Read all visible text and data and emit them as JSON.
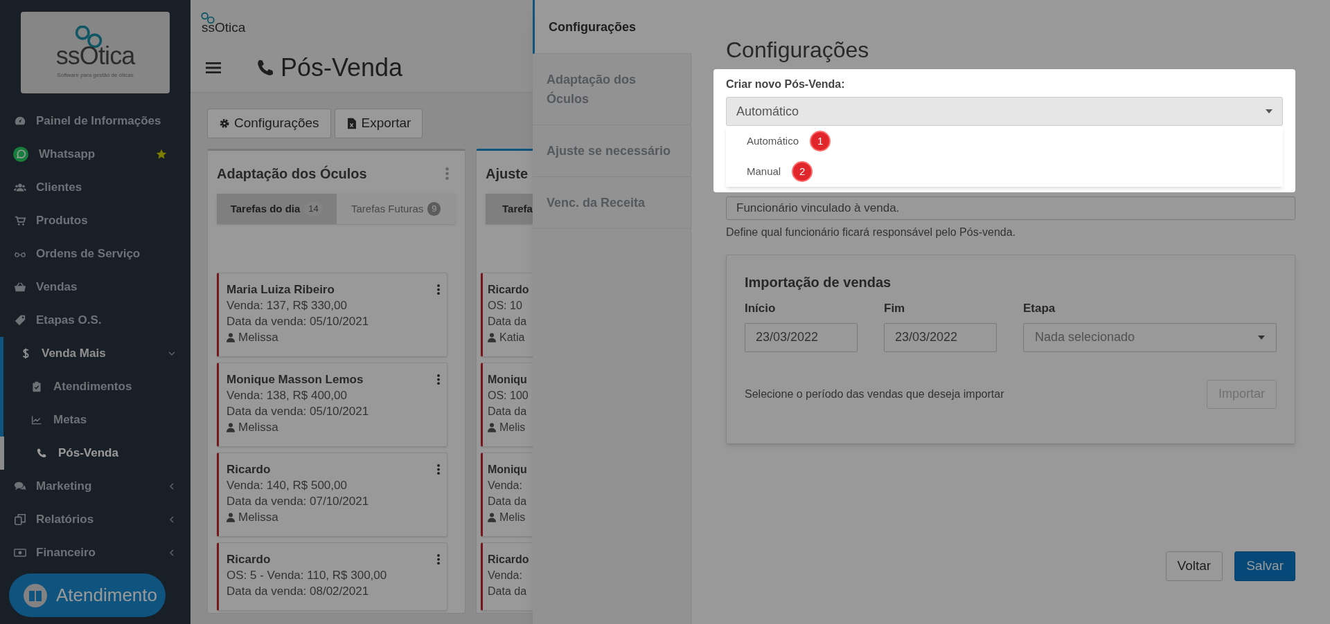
{
  "sidebar": {
    "logo": {
      "title": "ssOtica",
      "tagline": "Software para gestão de óticas"
    },
    "items": [
      {
        "label": "Painel de Informações",
        "kind": "link",
        "starred": false,
        "selected": false
      },
      {
        "label": "Whatsapp",
        "kind": "link",
        "starred": true,
        "selected": false
      },
      {
        "label": "Clientes",
        "kind": "link",
        "starred": false,
        "selected": false
      },
      {
        "label": "Produtos",
        "kind": "link",
        "starred": false,
        "selected": false
      },
      {
        "label": "Ordens de Serviço",
        "kind": "link",
        "starred": false,
        "selected": false
      },
      {
        "label": "Vendas",
        "kind": "link",
        "starred": false,
        "selected": false
      },
      {
        "label": "Etapas O.S.",
        "kind": "link",
        "starred": false,
        "selected": false
      },
      {
        "label": "Venda Mais",
        "kind": "group",
        "starred": false,
        "selected": false,
        "expanded": true,
        "children": [
          {
            "label": "Atendimentos",
            "selected": false
          },
          {
            "label": "Metas",
            "selected": false
          },
          {
            "label": "Pós-Venda",
            "selected": true
          }
        ]
      },
      {
        "label": "Marketing",
        "kind": "group",
        "starred": false,
        "selected": false,
        "expanded": false
      },
      {
        "label": "Relatórios",
        "kind": "group",
        "starred": false,
        "selected": false,
        "expanded": false
      },
      {
        "label": "Financeiro",
        "kind": "group",
        "starred": false,
        "selected": false,
        "expanded": false
      }
    ]
  },
  "chat_button": {
    "label": "Atendimento"
  },
  "header": {
    "brand": "ssOtica",
    "title": "Pós-Venda"
  },
  "toolbar": [
    {
      "label": "Configurações"
    },
    {
      "label": "Exportar"
    }
  ],
  "columns": [
    {
      "title": "Adaptação dos Óculos",
      "tabs": [
        {
          "label": "Tarefas do dia",
          "count": "14",
          "selected": true
        },
        {
          "label": "Tarefas Futuras",
          "count": "9",
          "selected": false
        }
      ],
      "cards": [
        {
          "name": "Maria Luiza Ribeiro",
          "line_1": "Venda: 137, R$ 330,00",
          "line_2": "Data da venda: 05/10/2021",
          "person": "Melissa"
        },
        {
          "name": "Monique Masson Lemos",
          "line_1": "Venda: 138, R$ 400,00",
          "line_2": "Data da venda: 05/10/2021",
          "person": "Melissa"
        },
        {
          "name": "Ricardo",
          "line_1": "Venda: 140, R$ 500,00",
          "line_2": "Data da venda: 07/10/2021",
          "person": "Melissa"
        },
        {
          "name": "Ricardo",
          "line_1": "OS: 5 - Venda: 110, R$ 300,00",
          "line_2": "Data da venda: 08/02/2021"
        }
      ]
    },
    {
      "title": "Ajuste",
      "tabs": [
        {
          "label": "Tarefa",
          "selected": true
        }
      ],
      "cards": [
        {
          "name": "Ricardo",
          "line_1": "OS: 10",
          "line_2": "Data da",
          "person": "Katia"
        },
        {
          "name": "Moniqu",
          "line_1": "OS: 100",
          "line_2": "Data da",
          "person": "Melis"
        },
        {
          "name": "Moniqu",
          "line_1": "Venda:",
          "line_2": "Data da",
          "person": "Melis"
        },
        {
          "name": "Ricardo",
          "line_1": "Venda:",
          "line_2": "Data da"
        }
      ]
    }
  ],
  "drawer": {
    "nav": [
      {
        "label": "Configurações",
        "selected": true
      },
      {
        "label": "Adaptação dos Óculos",
        "selected": false
      },
      {
        "label": "Ajuste se necessário",
        "selected": false
      },
      {
        "label": "Venc. da Receita",
        "selected": false
      }
    ],
    "heading": "Configurações",
    "create": {
      "label": "Criar novo Pós-Venda:",
      "value": "Automático",
      "options": [
        {
          "label": "Automático",
          "badge": "1"
        },
        {
          "label": "Manual",
          "badge": "2"
        }
      ]
    },
    "employee": {
      "value": "Funcionário vinculado à venda.",
      "help": "Define qual funcionário ficará responsável pelo Pós-venda."
    },
    "import": {
      "title": "Importação de vendas",
      "fields": [
        {
          "label": "Início",
          "value": "23/03/2022",
          "kind": "date"
        },
        {
          "label": "Fim",
          "value": "23/03/2022",
          "kind": "date"
        },
        {
          "label": "Etapa",
          "placeholder": "Nada selecionado",
          "kind": "select"
        }
      ],
      "hint": "Selecione o período das vendas que deseja importar",
      "button": "Importar"
    },
    "buttons": [
      {
        "label": "Voltar",
        "kind": "secondary"
      },
      {
        "label": "Salvar",
        "kind": "primary"
      }
    ]
  }
}
